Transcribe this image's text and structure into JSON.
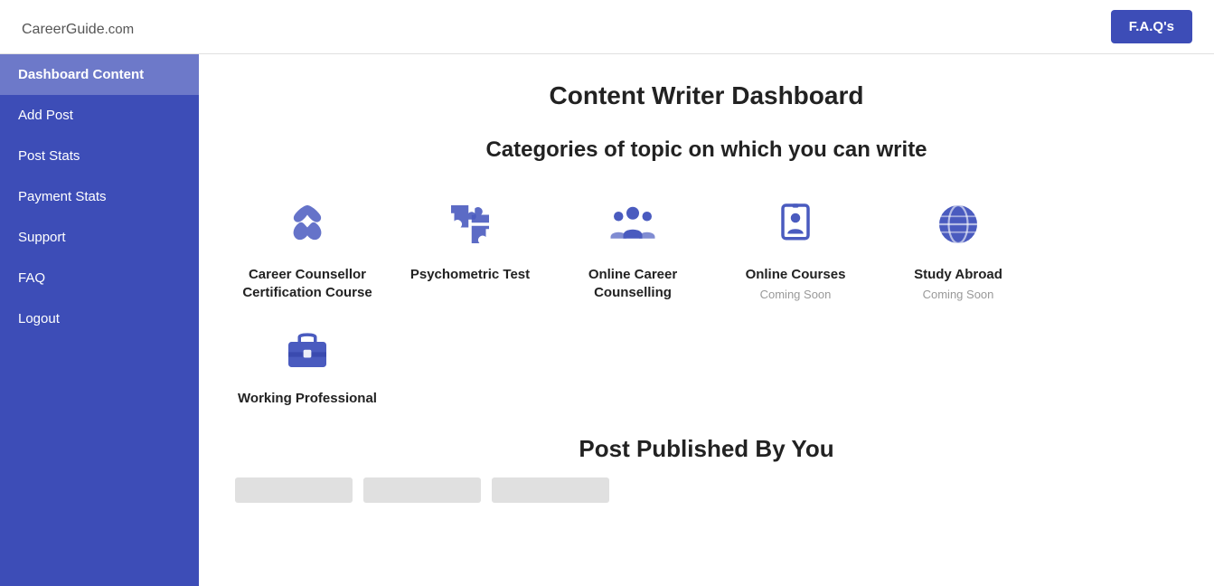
{
  "header": {
    "logo_main": "CareerGuide",
    "logo_suffix": ".com",
    "faq_button": "F.A.Q's"
  },
  "sidebar": {
    "items": [
      {
        "label": "Dashboard Content",
        "active": true
      },
      {
        "label": "Add Post",
        "active": false
      },
      {
        "label": "Post Stats",
        "active": false
      },
      {
        "label": "Payment Stats",
        "active": false
      },
      {
        "label": "Support",
        "active": false
      },
      {
        "label": "FAQ",
        "active": false
      },
      {
        "label": "Logout",
        "active": false
      }
    ]
  },
  "main": {
    "page_title": "Content Writer Dashboard",
    "categories_title": "Categories of topic on which you can write",
    "categories": [
      {
        "id": "career-counsellor",
        "label": "Career Counsellor Certification Course",
        "coming_soon": false,
        "icon": "briefcase-star"
      },
      {
        "id": "psychometric-test",
        "label": "Psychometric Test",
        "coming_soon": false,
        "icon": "puzzle"
      },
      {
        "id": "online-career-counselling",
        "label": "Online Career Counselling",
        "coming_soon": false,
        "icon": "people"
      },
      {
        "id": "online-courses",
        "label": "Online Courses",
        "coming_soon": true,
        "coming_soon_text": "Coming Soon",
        "icon": "tablet-person"
      },
      {
        "id": "study-abroad",
        "label": "Study Abroad",
        "coming_soon": true,
        "coming_soon_text": "Coming Soon",
        "icon": "globe"
      }
    ],
    "second_row_categories": [
      {
        "id": "working-professional",
        "label": "Working Professional",
        "coming_soon": false,
        "icon": "briefcase"
      }
    ],
    "post_published_title": "Post Published By You"
  }
}
